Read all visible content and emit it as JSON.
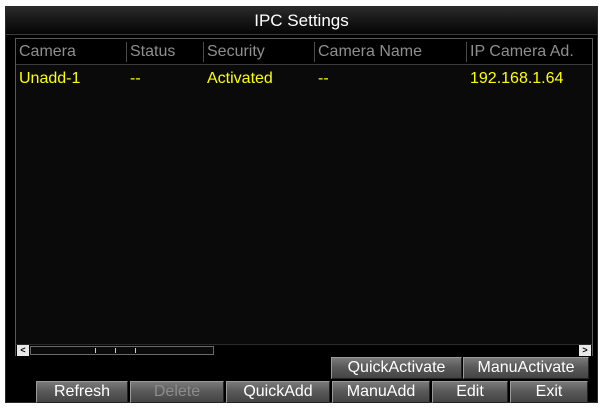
{
  "window": {
    "title": "IPC Settings"
  },
  "table": {
    "columns": [
      "Camera",
      "Status",
      "Security",
      "Camera Name",
      "IP Camera Ad."
    ],
    "rows": [
      {
        "camera": "Unadd-1",
        "status": "--",
        "security": "Activated",
        "camera_name": "--",
        "ip": "192.168.1.64"
      }
    ]
  },
  "scrollbar": {
    "left_arrow": "<",
    "right_arrow": ">"
  },
  "actions_top": {
    "quick_activate": "QuickActivate",
    "manu_activate": "ManuActivate"
  },
  "actions_bottom": {
    "refresh": "Refresh",
    "delete": "Delete",
    "quick_add": "QuickAdd",
    "manu_add": "ManuAdd",
    "edit": "Edit",
    "exit": "Exit"
  },
  "colors": {
    "row_text": "#ffff00",
    "header_text": "#8e8e8e",
    "button_text": "#ffffff",
    "disabled_text": "#8c8c8c"
  }
}
